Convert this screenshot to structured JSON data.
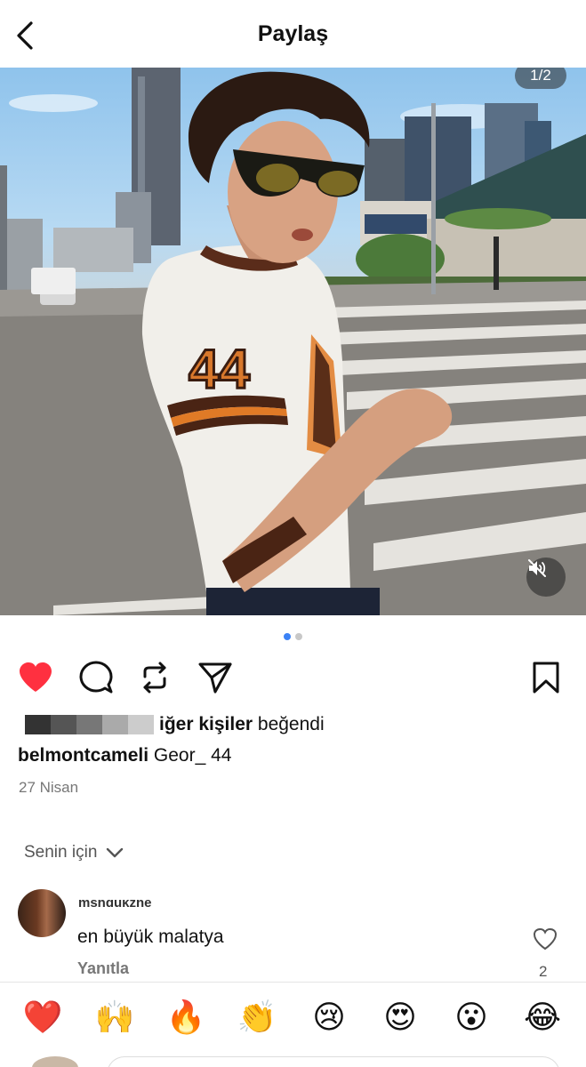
{
  "header": {
    "title": "Paylaş"
  },
  "photo": {
    "page_counter": "1/2"
  },
  "pager": {
    "current": 1,
    "total": 2
  },
  "likes": {
    "bold_text": "iğer kişiler",
    "rest_text": " beğendi",
    "redaction_colors": [
      "#333333",
      "#555555",
      "#777777",
      "#aaaaaa",
      "#cccccc"
    ]
  },
  "caption": {
    "username": "belmontcameli",
    "text": " Geor_ 44"
  },
  "date": "27 Nisan",
  "comments_sort": {
    "label": "Senin için"
  },
  "comment": {
    "username": "mshdukzne",
    "text": "en büyük malatya",
    "reply_label": "Yanıtla",
    "like_count": "2"
  },
  "emoji_bar": [
    "❤️",
    "🙌",
    "🔥",
    "👏",
    "😢",
    "😍",
    "😮",
    "😂"
  ],
  "colors": {
    "like_red": "#ff3040",
    "active_dot": "#3b82f6"
  },
  "icons": [
    "back-arrow-icon",
    "heart-icon",
    "comment-icon",
    "repost-icon",
    "send-icon",
    "bookmark-icon",
    "mute-icon",
    "chevron-down-icon",
    "heart-outline-icon"
  ]
}
